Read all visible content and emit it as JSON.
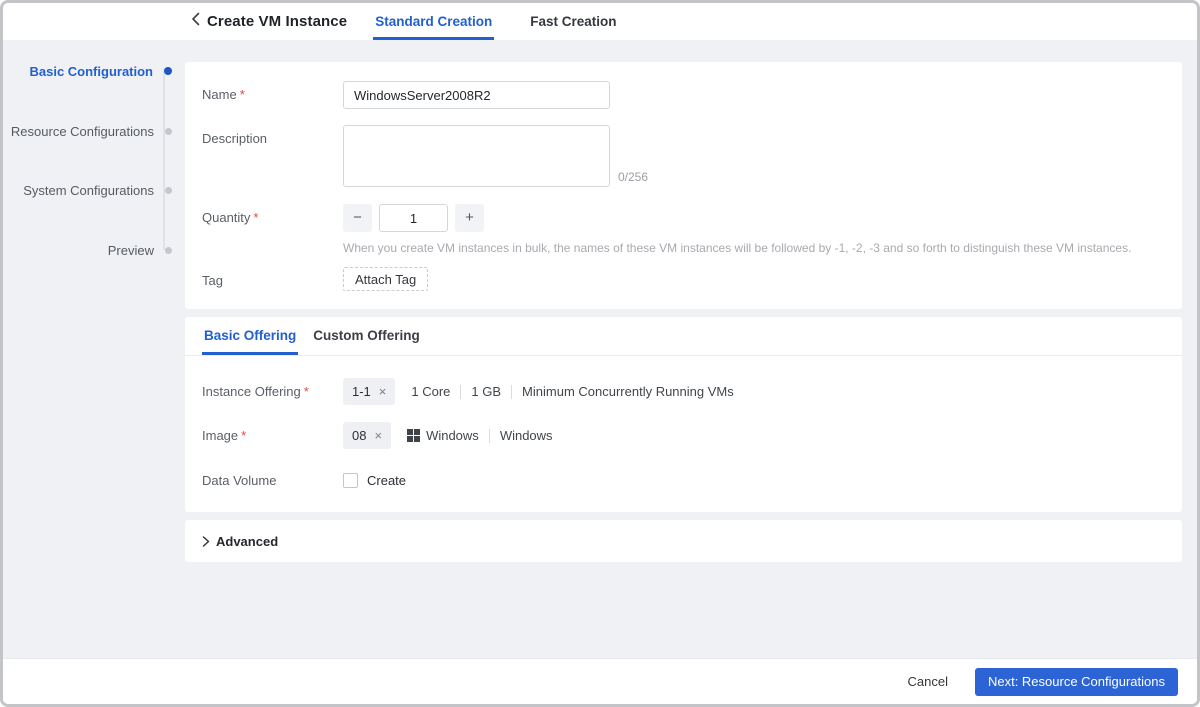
{
  "header": {
    "title": "Create VM Instance",
    "tabs": [
      {
        "label": "Standard Creation",
        "active": true
      },
      {
        "label": "Fast Creation",
        "active": false
      }
    ]
  },
  "stepper": {
    "steps": [
      {
        "label": "Basic Configuration",
        "active": true
      },
      {
        "label": "Resource Configurations",
        "active": false
      },
      {
        "label": "System Configurations",
        "active": false
      },
      {
        "label": "Preview",
        "active": false
      }
    ]
  },
  "basic_config": {
    "name": {
      "label": "Name",
      "required_mark": "*",
      "value": "WindowsServer2008R2"
    },
    "description": {
      "label": "Description",
      "value": "",
      "counter": "0/256"
    },
    "quantity": {
      "label": "Quantity",
      "required_mark": "*",
      "value": "1",
      "decrease": "−",
      "increase": "+",
      "help": "When you create VM instances in bulk, the names of these VM instances will be followed by -1, -2, -3 and so forth to distinguish these VM instances."
    },
    "tag": {
      "label": "Tag",
      "attach_button": "Attach Tag"
    }
  },
  "offering": {
    "tabs": [
      {
        "label": "Basic Offering",
        "active": true
      },
      {
        "label": "Custom Offering",
        "active": false
      }
    ],
    "instance_offering": {
      "label": "Instance Offering",
      "required_mark": "*",
      "chip": {
        "text": "1-1",
        "close": "×"
      },
      "details": [
        "1 Core",
        "1 GB",
        "Minimum Concurrently Running VMs"
      ]
    },
    "image": {
      "label": "Image",
      "required_mark": "*",
      "chip": {
        "text": "08",
        "close": "×"
      },
      "os_icon": "windows-logo",
      "details": [
        "Windows",
        "Windows"
      ]
    },
    "data_volume": {
      "label": "Data Volume",
      "checkbox_label": "Create",
      "checked": false
    }
  },
  "advanced": {
    "label": "Advanced"
  },
  "footer": {
    "cancel_label": "Cancel",
    "next_label": "Next: Resource Configurations"
  },
  "colors": {
    "accent": "#2260cf",
    "button": "#2c63d5",
    "required": "#e54545",
    "page_bg": "#eff1f5",
    "card_bg": "#ffffff"
  }
}
